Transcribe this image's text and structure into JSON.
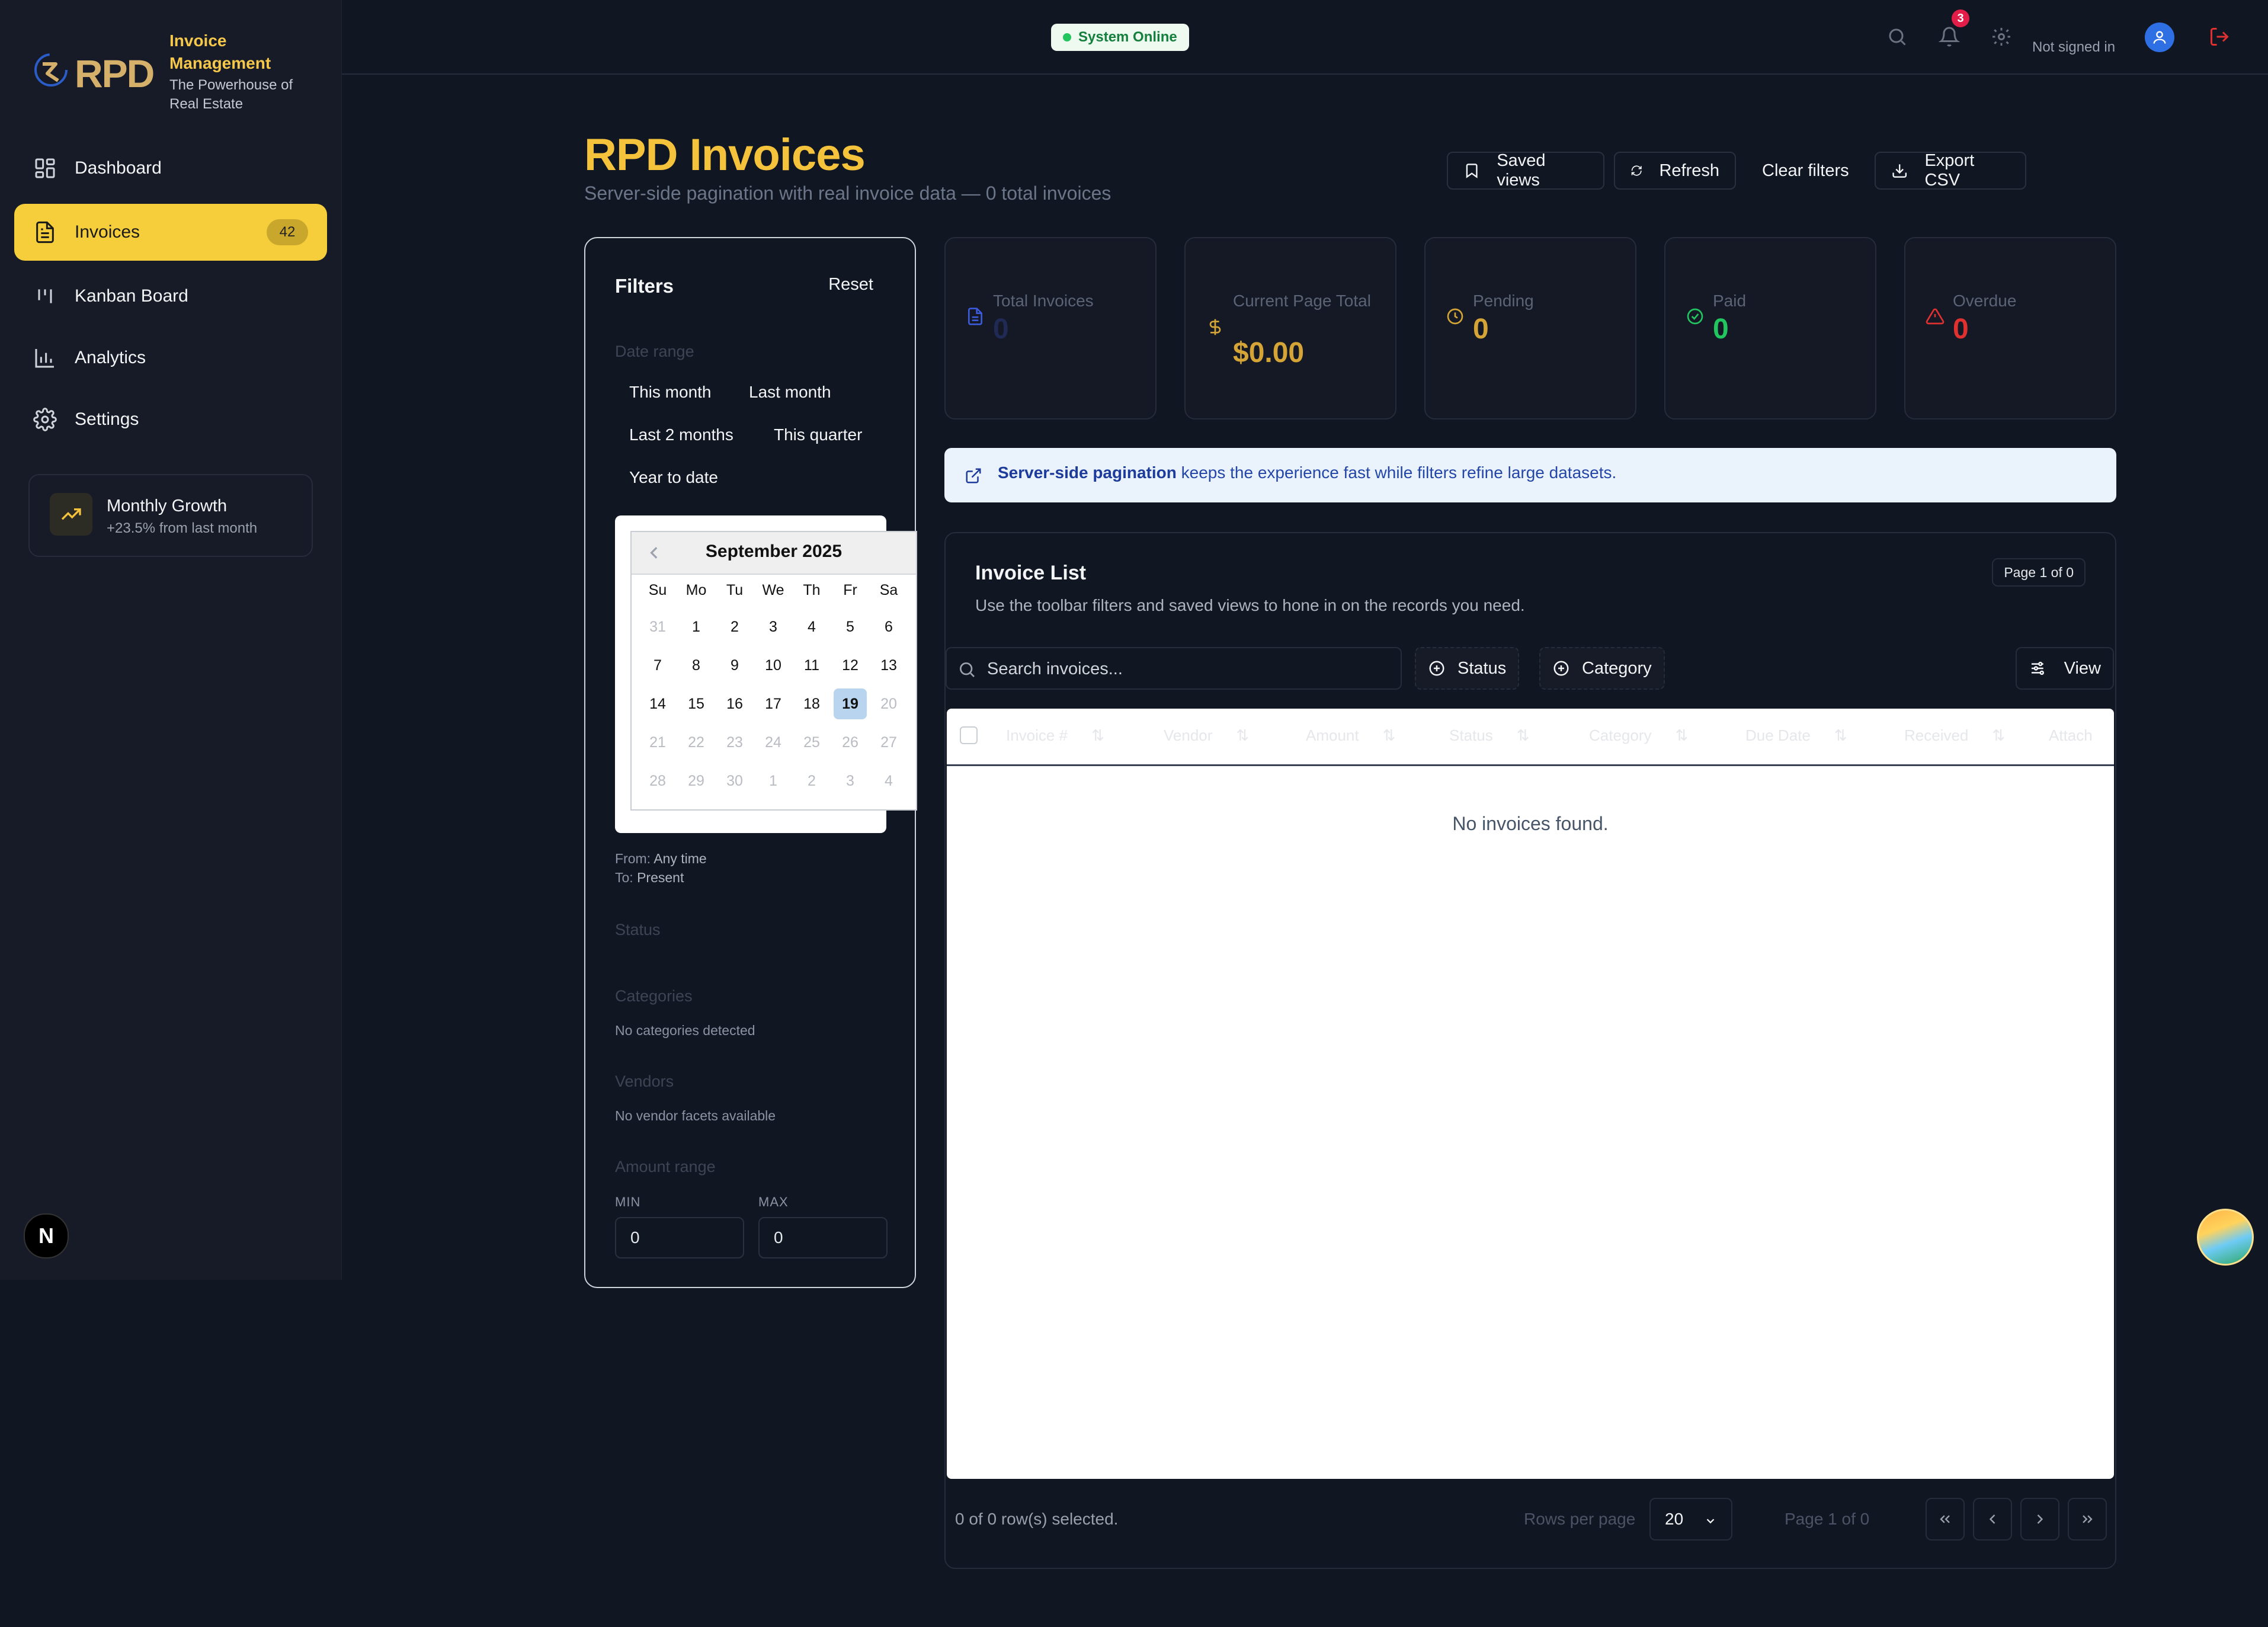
{
  "brand": {
    "logo_text": "RPD",
    "title": "Invoice Management",
    "subtitle": "The Powerhouse of Real Estate"
  },
  "sidebar": {
    "items": [
      {
        "label": "Dashboard",
        "icon": "dashboard-icon"
      },
      {
        "label": "Invoices",
        "icon": "file-text-icon",
        "badge": "42",
        "active": true
      },
      {
        "label": "Kanban Board",
        "icon": "kanban-icon"
      },
      {
        "label": "Analytics",
        "icon": "bar-chart-icon"
      },
      {
        "label": "Settings",
        "icon": "gear-icon"
      }
    ],
    "growth_card": {
      "title": "Monthly Growth",
      "subtitle": "+23.5% from last month",
      "icon": "trending-up-icon"
    },
    "n_badge": "N"
  },
  "header": {
    "status_pill": "System Online",
    "notification_count": "3",
    "user_status": "Not signed in",
    "icons": [
      "search-icon",
      "bell-icon",
      "gear-icon",
      "user-icon",
      "logout-icon"
    ]
  },
  "page": {
    "title": "RPD Invoices",
    "subtitle": "Server-side pagination with real invoice data — 0 total invoices",
    "toolbar": {
      "saved_views": "Saved views",
      "refresh": "Refresh",
      "clear_filters": "Clear filters",
      "export_csv": "Export CSV"
    }
  },
  "filters": {
    "title": "Filters",
    "reset": "Reset",
    "date_range_label": "Date range",
    "presets": [
      "This month",
      "Last month",
      "Last 2 months",
      "This quarter",
      "Year to date"
    ],
    "calendar": {
      "month": "September 2025",
      "weekdays": [
        "Su",
        "Mo",
        "Tu",
        "We",
        "Th",
        "Fr",
        "Sa"
      ],
      "weeks": [
        [
          "31",
          "1",
          "2",
          "3",
          "4",
          "5",
          "6"
        ],
        [
          "7",
          "8",
          "9",
          "10",
          "11",
          "12",
          "13"
        ],
        [
          "14",
          "15",
          "16",
          "17",
          "18",
          "19",
          "20"
        ],
        [
          "21",
          "22",
          "23",
          "24",
          "25",
          "26",
          "27"
        ],
        [
          "28",
          "29",
          "30",
          "1",
          "2",
          "3",
          "4"
        ]
      ],
      "selected": "19"
    },
    "from_label": "From:",
    "from_value": "Any time",
    "to_label": "To:",
    "to_value": "Present",
    "status_label": "Status",
    "categories_label": "Categories",
    "categories_empty": "No categories detected",
    "vendors_label": "Vendors",
    "vendors_empty": "No vendor facets available",
    "amount_label": "Amount range",
    "min_label": "MIN",
    "max_label": "MAX",
    "min_value": "0",
    "max_value": "0"
  },
  "stats": [
    {
      "label": "Total Invoices",
      "value": "0",
      "color": "#3b5bdb",
      "icon": "file-icon"
    },
    {
      "label": "Current Page Total",
      "value": "$0.00",
      "color": "#d4a437",
      "icon": "dollar-icon"
    },
    {
      "label": "Pending",
      "value": "0",
      "color": "#d4a437",
      "icon": "clock-icon"
    },
    {
      "label": "Paid",
      "value": "0",
      "color": "#22c55e",
      "icon": "check-circle-icon"
    },
    {
      "label": "Overdue",
      "value": "0",
      "color": "#e03131",
      "icon": "alert-triangle-icon"
    }
  ],
  "banner": {
    "bold": "Server-side pagination",
    "text": " keeps the experience fast while filters refine large datasets."
  },
  "invoice_list": {
    "title": "Invoice List",
    "subtitle": "Use the toolbar filters and saved views to hone in on the records you need.",
    "page_badge": "Page 1 of 0",
    "search_placeholder": "Search invoices...",
    "status_chip": "Status",
    "category_chip": "Category",
    "view_button": "View",
    "columns": [
      "Invoice #",
      "Vendor",
      "Amount",
      "Status",
      "Category",
      "Due Date",
      "Received",
      "Attach"
    ],
    "empty_message": "No invoices found.",
    "selection": "0 of 0 row(s) selected.",
    "rows_per_page_label": "Rows per page",
    "rows_per_page": "20",
    "page_info": "Page 1 of 0"
  }
}
